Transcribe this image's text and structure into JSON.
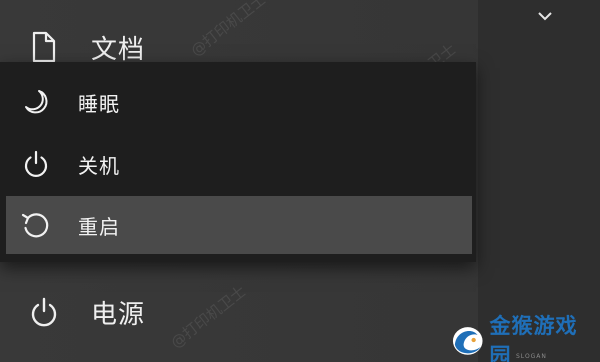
{
  "start_menu": {
    "documents_label": "文档",
    "power_label": "电源"
  },
  "power_flyout": {
    "items": [
      {
        "label": "睡眠",
        "icon": "moon-icon"
      },
      {
        "label": "关机",
        "icon": "power-icon"
      },
      {
        "label": "重启",
        "icon": "restart-icon"
      }
    ],
    "highlighted": "重启"
  },
  "watermark_text": "@打印机卫士",
  "logo": {
    "text": "金猴游戏园",
    "sub": "SLOGAN"
  },
  "colors": {
    "background": "#363636",
    "flyout_background": "#1e1e1e",
    "highlight": "#4a4a4a",
    "text": "#efefef",
    "logo_blue": "#1f6fb8"
  }
}
